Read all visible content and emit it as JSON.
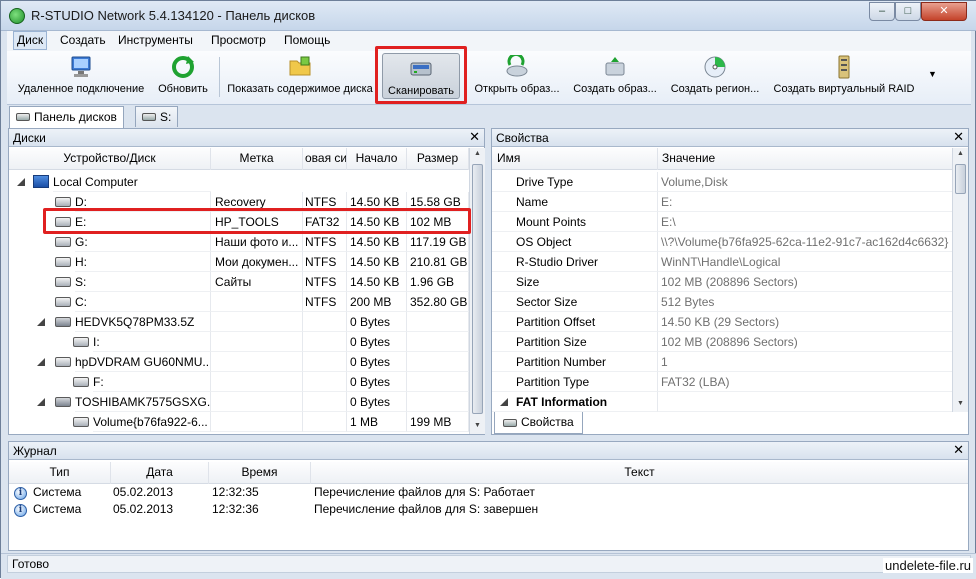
{
  "window": {
    "title": "R-STUDIO Network 5.4.134120 - Панель дисков",
    "min": "–",
    "max": "□",
    "close": "✕"
  },
  "menu": [
    {
      "label": "Диск"
    },
    {
      "label": "Создать"
    },
    {
      "label": "Инструменты"
    },
    {
      "label": "Просмотр"
    },
    {
      "label": "Помощь"
    }
  ],
  "toolbar": {
    "remote": "Удаленное подключение",
    "refresh": "Обновить",
    "show_contents": "Показать содержимое диска",
    "scan": "Сканировать",
    "open_image": "Открыть образ...",
    "create_image": "Создать образ...",
    "create_region": "Создать регион...",
    "create_raid": "Создать виртуальный RAID",
    "more": "▼"
  },
  "doc_tabs": [
    {
      "label": "Панель дисков"
    },
    {
      "label": "S:"
    }
  ],
  "disks_panel": {
    "title": "Диски",
    "close": "✕",
    "columns": [
      "Устройство/Диск",
      "Метка",
      "овая си",
      "Начало",
      "Размер"
    ],
    "rows": [
      {
        "name": "Local Computer",
        "label": "",
        "fs": "",
        "start": "",
        "size": ""
      },
      {
        "name": "D:",
        "label": "Recovery",
        "fs": "NTFS",
        "start": "14.50 KB",
        "size": "15.58 GB"
      },
      {
        "name": "E:",
        "label": "HP_TOOLS",
        "fs": "FAT32",
        "start": "14.50 KB",
        "size": "102 MB"
      },
      {
        "name": "G:",
        "label": "Наши фото и...",
        "fs": "NTFS",
        "start": "14.50 KB",
        "size": "117.19 GB"
      },
      {
        "name": "H:",
        "label": "Мои докумен...",
        "fs": "NTFS",
        "start": "14.50 KB",
        "size": "210.81 GB"
      },
      {
        "name": "S:",
        "label": "Сайты",
        "fs": "NTFS",
        "start": "14.50 KB",
        "size": "1.96 GB"
      },
      {
        "name": "C:",
        "label": "",
        "fs": "NTFS",
        "start": "200 MB",
        "size": "352.80 GB"
      },
      {
        "name": "HEDVK5Q78PM33.5Z",
        "label": "",
        "fs": "",
        "start": "0 Bytes",
        "size": ""
      },
      {
        "name": "I:",
        "label": "",
        "fs": "",
        "start": "0 Bytes",
        "size": ""
      },
      {
        "name": "hpDVDRAM GU60NMU...",
        "label": "",
        "fs": "",
        "start": "0 Bytes",
        "size": ""
      },
      {
        "name": "F:",
        "label": "",
        "fs": "",
        "start": "0 Bytes",
        "size": ""
      },
      {
        "name": "TOSHIBAMK7575GSXG...",
        "label": "",
        "fs": "",
        "start": "0 Bytes",
        "size": ""
      },
      {
        "name": "Volume{b76fa922-6...",
        "label": "",
        "fs": "",
        "start": "1 MB",
        "size": "199 MB"
      }
    ]
  },
  "props_panel": {
    "title": "Свойства",
    "close": "✕",
    "columns": [
      "Имя",
      "Значение"
    ],
    "rows": [
      {
        "name": "Drive Type",
        "value": "Volume,Disk"
      },
      {
        "name": "Name",
        "value": "E:"
      },
      {
        "name": "Mount Points",
        "value": "E:\\"
      },
      {
        "name": "OS Object",
        "value": "\\\\?\\Volume{b76fa925-62ca-11e2-91c7-ac162d4c6632}"
      },
      {
        "name": "R-Studio Driver",
        "value": "WinNT\\Handle\\Logical"
      },
      {
        "name": "Size",
        "value": "102 MB (208896 Sectors)"
      },
      {
        "name": "Sector Size",
        "value": "512 Bytes"
      },
      {
        "name": "Partition Offset",
        "value": "14.50 KB (29 Sectors)"
      },
      {
        "name": "Partition Size",
        "value": "102 MB (208896 Sectors)"
      },
      {
        "name": "Partition Number",
        "value": "1"
      },
      {
        "name": "Partition Type",
        "value": "FAT32 (LBA)"
      },
      {
        "name": "FAT Information",
        "value": ""
      }
    ],
    "tab": "Свойства"
  },
  "log_panel": {
    "title": "Журнал",
    "close": "✕",
    "columns": [
      "Тип",
      "Дата",
      "Время",
      "Текст"
    ],
    "rows": [
      {
        "type": "Система",
        "date": "05.02.2013",
        "time": "12:32:35",
        "text": "Перечисление файлов для S: Работает"
      },
      {
        "type": "Система",
        "date": "05.02.2013",
        "time": "12:32:36",
        "text": "Перечисление файлов для S: завершен"
      }
    ]
  },
  "status": {
    "text": "Готово",
    "watermark": "undelete-file.ru"
  }
}
